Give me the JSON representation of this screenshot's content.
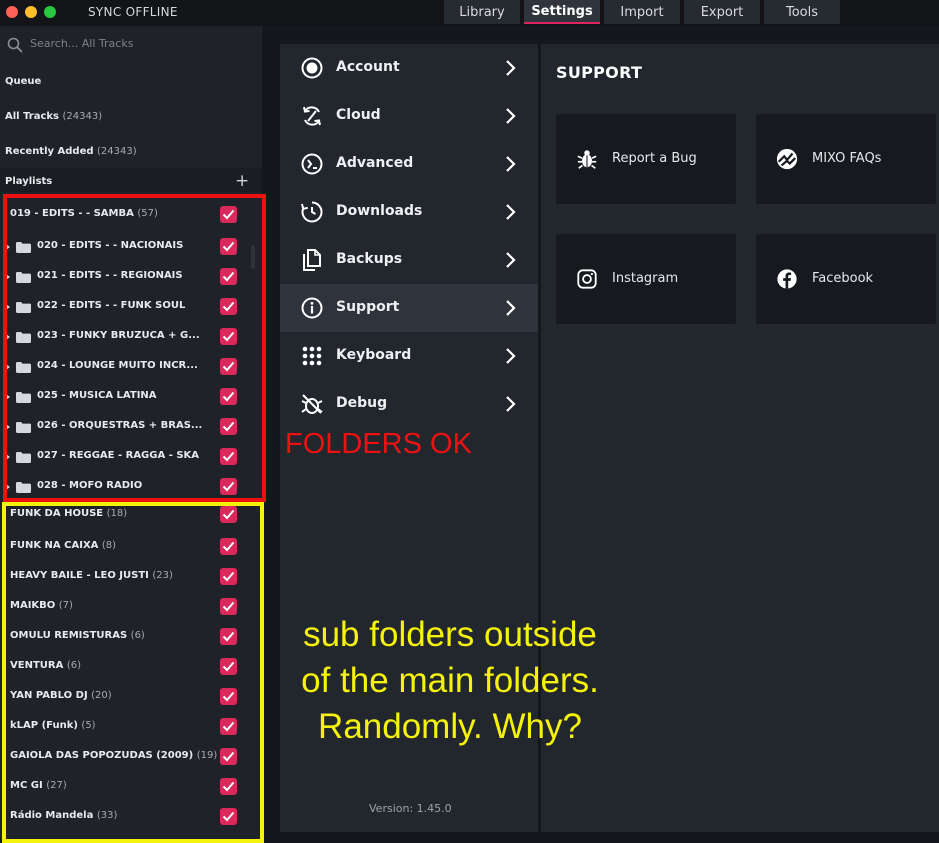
{
  "window": {
    "title": "SYNC OFFLINE",
    "traffic_lights": [
      {
        "name": "close",
        "color": "#fe5f57"
      },
      {
        "name": "minimize",
        "color": "#febc2e"
      },
      {
        "name": "zoom",
        "color": "#28c840"
      }
    ]
  },
  "tabs": [
    {
      "label": "Library",
      "active": false
    },
    {
      "label": "Settings",
      "active": true
    },
    {
      "label": "Import",
      "active": false
    },
    {
      "label": "Export",
      "active": false
    },
    {
      "label": "Tools",
      "active": false
    }
  ],
  "sidebar": {
    "search_placeholder": "Search... All Tracks",
    "nav": [
      {
        "label": "Queue",
        "count": ""
      },
      {
        "label": "All Tracks",
        "count": "(24343)"
      },
      {
        "label": "Recently Added",
        "count": "(24343)"
      }
    ],
    "playlists_label": "Playlists",
    "add_icon": "+",
    "playlists": [
      {
        "label": "019 - EDITS - - SAMBA",
        "count": "(57)",
        "folder": false,
        "checked": true
      },
      {
        "label": "020 - EDITS - - NACIONAIS",
        "count": "",
        "folder": true,
        "checked": true
      },
      {
        "label": "021 - EDITS - - REGIONAIS",
        "count": "",
        "folder": true,
        "checked": true
      },
      {
        "label": "022 - EDITS - - FUNK SOUL",
        "count": "",
        "folder": true,
        "checked": true
      },
      {
        "label": "023 - FUNKY BRUZUCA + G...",
        "count": "",
        "folder": true,
        "checked": true
      },
      {
        "label": "024 - LOUNGE MUITO INCR...",
        "count": "",
        "folder": true,
        "checked": true
      },
      {
        "label": "025 - MUSICA LATINA",
        "count": "",
        "folder": true,
        "checked": true
      },
      {
        "label": "026 - ORQUESTRAS + BRAS...",
        "count": "",
        "folder": true,
        "checked": true
      },
      {
        "label": "027 - REGGAE - RAGGA - SKA",
        "count": "",
        "folder": true,
        "checked": true
      },
      {
        "label": "028 - MOFO RADIO",
        "count": "",
        "folder": true,
        "checked": true
      },
      {
        "label": "FUNK DA HOUSE",
        "count": "(18)",
        "folder": false,
        "checked": true
      },
      {
        "label": "FUNK NA CAIXA",
        "count": "(8)",
        "folder": false,
        "checked": true
      },
      {
        "label": "HEAVY BAILE - LEO JUSTI",
        "count": "(23)",
        "folder": false,
        "checked": true
      },
      {
        "label": "MAIKBO",
        "count": "(7)",
        "folder": false,
        "checked": true
      },
      {
        "label": "OMULU REMISTURAS",
        "count": "(6)",
        "folder": false,
        "checked": true
      },
      {
        "label": "VENTURA",
        "count": "(6)",
        "folder": false,
        "checked": true
      },
      {
        "label": "YAN PABLO DJ",
        "count": "(20)",
        "folder": false,
        "checked": true
      },
      {
        "label": "kLAP (Funk)",
        "count": "(5)",
        "folder": false,
        "checked": true
      },
      {
        "label": "GAIOLA DAS POPOZUDAS (2009)",
        "count": "(19)",
        "folder": false,
        "checked": true
      },
      {
        "label": "MC GI",
        "count": "(27)",
        "folder": false,
        "checked": true
      },
      {
        "label": "Rádio Mandela",
        "count": "(33)",
        "folder": false,
        "checked": true
      }
    ]
  },
  "settings_menu": {
    "items": [
      {
        "label": "Account",
        "icon": "account-icon",
        "active": false
      },
      {
        "label": "Cloud",
        "icon": "cloud-sync-icon",
        "active": false
      },
      {
        "label": "Advanced",
        "icon": "advanced-icon",
        "active": false
      },
      {
        "label": "Downloads",
        "icon": "downloads-icon",
        "active": false
      },
      {
        "label": "Backups",
        "icon": "backups-icon",
        "active": false
      },
      {
        "label": "Support",
        "icon": "info-icon",
        "active": true
      },
      {
        "label": "Keyboard",
        "icon": "keyboard-dots-icon",
        "active": false
      },
      {
        "label": "Debug",
        "icon": "debug-icon",
        "active": false
      }
    ],
    "version": "Version: 1.45.0"
  },
  "support": {
    "title": "SUPPORT",
    "cards": [
      {
        "label": "Report a Bug",
        "icon": "bug-icon"
      },
      {
        "label": "MIXO FAQs",
        "icon": "mixo-logo-icon"
      },
      {
        "label": "Instagram",
        "icon": "instagram-icon"
      },
      {
        "label": "Facebook",
        "icon": "facebook-icon"
      }
    ]
  },
  "annotations": {
    "folders_ok": "FOLDERS OK",
    "note_lines": [
      "sub folders outside",
      "of the main folders.",
      "Randomly. Why?"
    ],
    "red_color": "#ee1111",
    "yellow_color": "#f5f20c"
  },
  "colors": {
    "accent": "#d92a5b",
    "background": "#14171c",
    "panel": "#22272e"
  }
}
